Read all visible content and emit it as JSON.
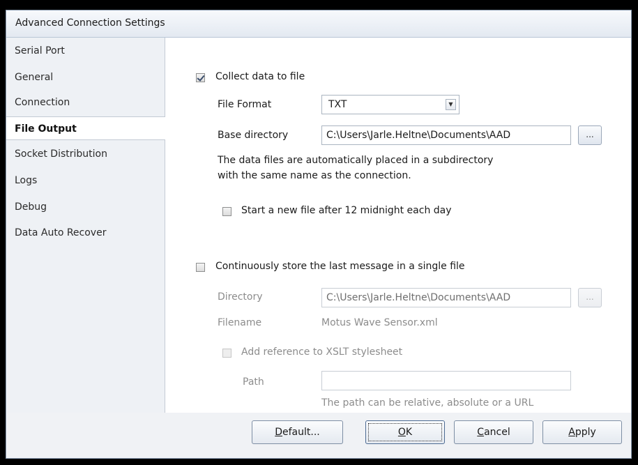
{
  "window": {
    "title": "Advanced Connection Settings"
  },
  "sidebar": {
    "items": [
      {
        "label": "Serial Port"
      },
      {
        "label": "General"
      },
      {
        "label": "Connection"
      },
      {
        "label": "File Output",
        "active": true
      },
      {
        "label": "Socket Distribution"
      },
      {
        "label": "Logs"
      },
      {
        "label": "Debug"
      },
      {
        "label": "Data Auto Recover"
      }
    ]
  },
  "file_output": {
    "collect_label": "Collect data to file",
    "collect_checked": true,
    "format_label": "File Format",
    "format_value": "TXT",
    "base_dir_label": "Base directory",
    "base_dir_value": "C:\\Users\\Jarle.Heltne\\Documents\\AAD",
    "browse_label": "...",
    "info_line1": "The data files are automatically placed in a subdirectory",
    "info_line2": "with the same name as the connection.",
    "midnight_label": "Start a new file after 12 midnight each day",
    "midnight_checked": false
  },
  "last_message": {
    "continuous_label": "Continuously store the last message in a single file",
    "continuous_checked": false,
    "directory_label": "Directory",
    "directory_value": "C:\\Users\\Jarle.Heltne\\Documents\\AAD",
    "browse_label": "...",
    "filename_label": "Filename",
    "filename_value": "Motus Wave Sensor.xml",
    "xslt_label": "Add reference to XSLT stylesheet",
    "xslt_checked": false,
    "path_label": "Path",
    "path_value": "",
    "path_hint": "The path can be relative, absolute or a URL"
  },
  "buttons": {
    "default_hotkey": "D",
    "default_rest": "efault...",
    "ok_hotkey": "O",
    "ok_rest": "K",
    "cancel_hotkey": "C",
    "cancel_rest": "ancel",
    "apply_hotkey": "A",
    "apply_rest": "pply"
  }
}
